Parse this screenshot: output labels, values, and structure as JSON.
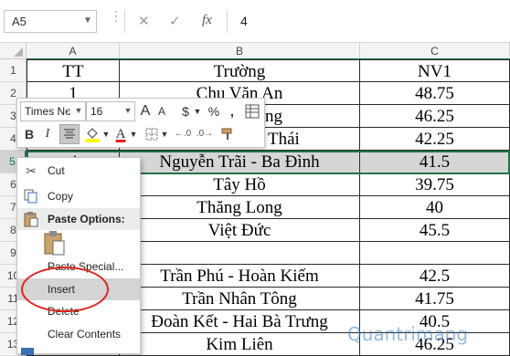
{
  "formula_bar": {
    "name_box": "A5",
    "cancel_icon": "✕",
    "enter_icon": "✓",
    "fx_label": "fx",
    "formula_value": "4"
  },
  "columns": [
    "A",
    "B",
    "C"
  ],
  "row_numbers": [
    "1",
    "2",
    "3",
    "4",
    "5",
    "6",
    "7",
    "8",
    "9",
    "10",
    "11",
    "12",
    "13"
  ],
  "rows": [
    {
      "tt": "TT",
      "truong": "Trường",
      "nv1": "NV1"
    },
    {
      "tt": "1",
      "truong": "Chu Văn An",
      "nv1": "48.75"
    },
    {
      "tt": "",
      "truong": "hùng",
      "nv1": "46.25"
    },
    {
      "tt": "",
      "truong": "Thái",
      "nv1": "42.25"
    },
    {
      "tt": "4",
      "truong": "Nguyễn Trãi - Ba Đình",
      "nv1": "41.5"
    },
    {
      "tt": "",
      "truong": "Tây Hồ",
      "nv1": "39.75"
    },
    {
      "tt": "",
      "truong": "Thăng Long",
      "nv1": "40"
    },
    {
      "tt": "",
      "truong": "Việt Đức",
      "nv1": "45.5"
    },
    {
      "tt": "",
      "truong": "",
      "nv1": ""
    },
    {
      "tt": "",
      "truong": "Trần Phú - Hoàn Kiếm",
      "nv1": "42.5"
    },
    {
      "tt": "",
      "truong": "Trần Nhân Tông",
      "nv1": "41.75"
    },
    {
      "tt": "",
      "truong": "Đoàn Kết - Hai Bà Trưng",
      "nv1": "40.5"
    },
    {
      "tt": "",
      "truong": "Kim Liên",
      "nv1": "46.25"
    }
  ],
  "selected_row": "5",
  "mini_toolbar": {
    "font_name": "Times Nє",
    "font_size": "16",
    "grow_font": "A",
    "shrink_font": "A",
    "currency": "$",
    "percent": "%",
    "comma": ",",
    "bold": "B",
    "italic": "I",
    "font_color_letter": "A"
  },
  "context_menu": {
    "items": [
      {
        "label": "Cut",
        "icon": "scissors-icon"
      },
      {
        "label": "Copy",
        "icon": "copy-icon"
      },
      {
        "label": "Paste Options:",
        "icon": "clipboard-icon"
      },
      {
        "label": "Paste Special...",
        "icon": ""
      },
      {
        "label": "Insert",
        "icon": ""
      },
      {
        "label": "Delete",
        "icon": ""
      },
      {
        "label": "Clear Contents",
        "icon": ""
      }
    ]
  },
  "colors": {
    "accent_green": "#217346",
    "highlight_circle": "#e0261e",
    "selected_row_fill": "#d6d6d6"
  },
  "watermark": "Quantrimang"
}
